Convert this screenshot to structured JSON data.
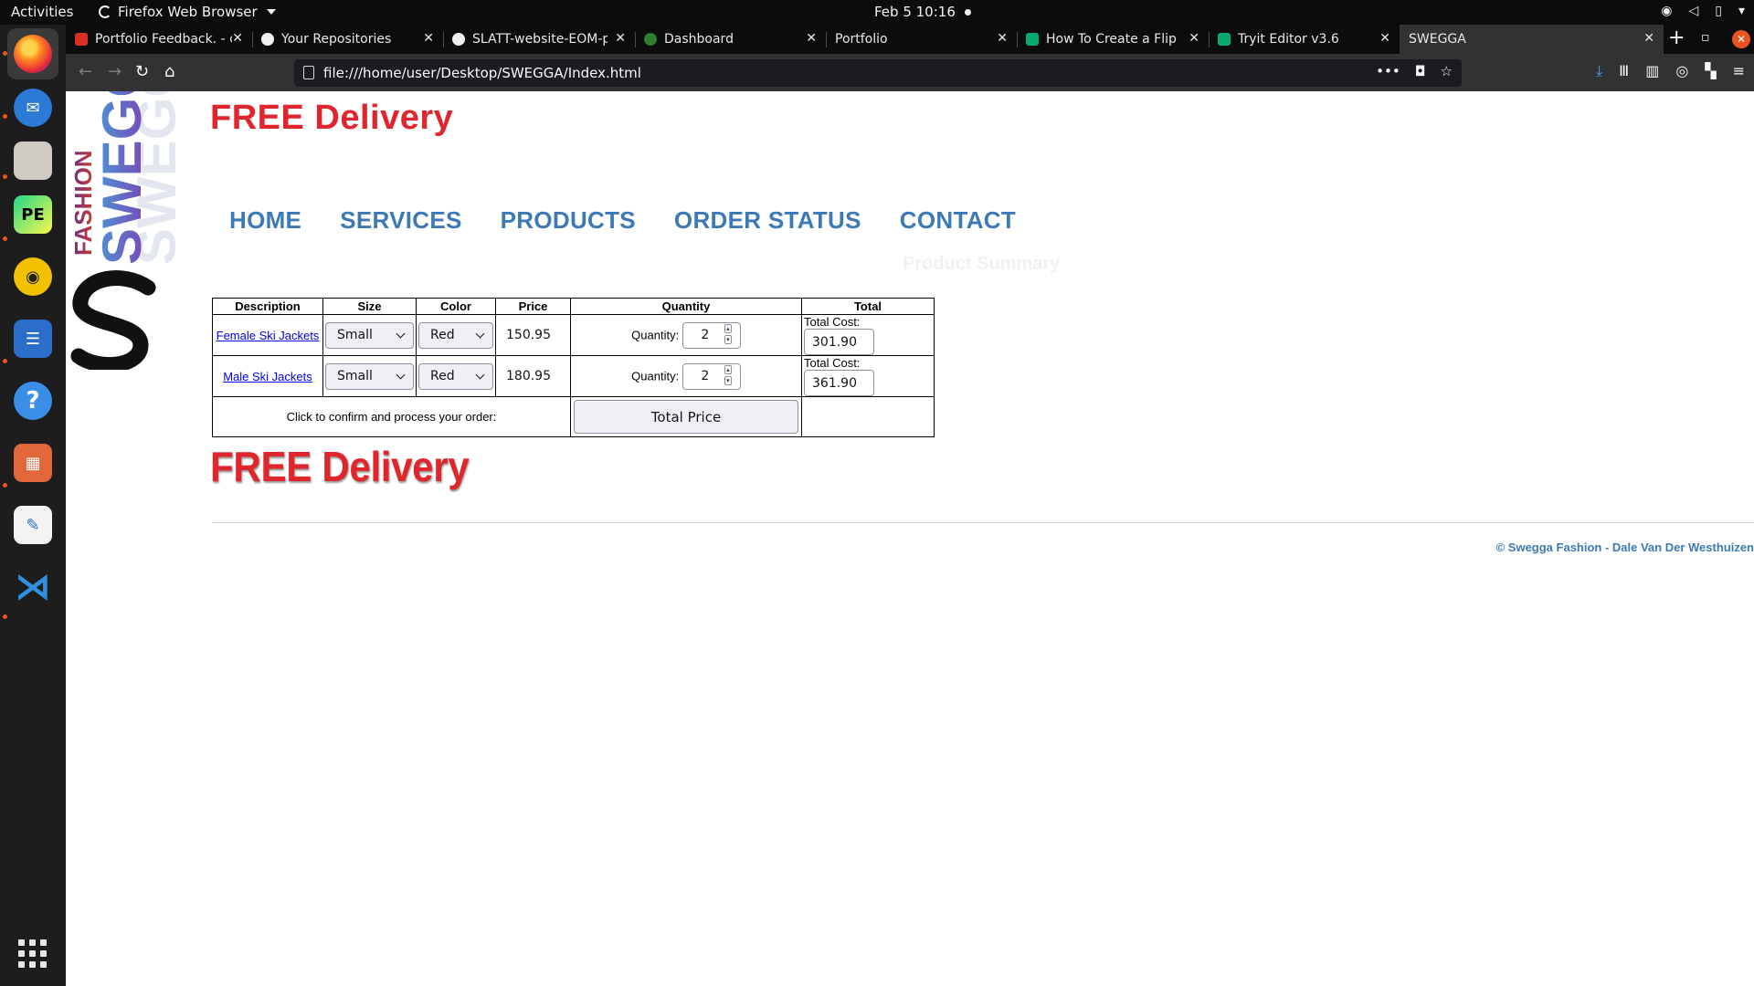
{
  "system": {
    "activities": "Activities",
    "app_menu": "Firefox Web Browser",
    "clock": "Feb 5  10:16"
  },
  "browser": {
    "tabs": [
      {
        "label": "Portfolio Feedback. - c",
        "icon": "gmail-icon",
        "color": "#d93025"
      },
      {
        "label": "Your Repositories",
        "icon": "github-icon",
        "color": "#f0f0f0"
      },
      {
        "label": "SLATT-website-EOM-p",
        "icon": "github-icon",
        "color": "#f0f0f0"
      },
      {
        "label": "Dashboard",
        "icon": "dashboard-icon",
        "color": "#2e7d32"
      },
      {
        "label": "Portfolio",
        "icon": "",
        "color": ""
      },
      {
        "label": "How To Create a Flip C",
        "icon": "w3-icon",
        "color": "#04aa6d"
      },
      {
        "label": "Tryit Editor v3.6",
        "icon": "w3-icon",
        "color": "#04aa6d"
      },
      {
        "label": "SWEGGA",
        "icon": "",
        "color": ""
      }
    ],
    "url": "file:///home/user/Desktop/SWEGGA/Index.html"
  },
  "page": {
    "logo": {
      "word1": "FASHION",
      "word2": "SWEGGA"
    },
    "free_delivery_top": "FREE Delivery",
    "free_delivery_bottom": "FREE Delivery",
    "nav": [
      "HOME",
      "SERVICES",
      "PRODUCTS",
      "ORDER STATUS",
      "CONTACT"
    ],
    "ghost_title": "Product Summary",
    "table": {
      "headers": [
        "Description",
        "Size",
        "Color",
        "Price",
        "Quantity",
        "Total"
      ],
      "rows": [
        {
          "description": "Female Ski Jackets",
          "size": "Small",
          "color": "Red",
          "price": "150.95",
          "quantity_label": "Quantity:",
          "quantity": "2",
          "total_label": "Total Cost:",
          "total": "301.90"
        },
        {
          "description": "Male Ski Jackets",
          "size": "Small",
          "color": "Red",
          "price": "180.95",
          "quantity_label": "Quantity:",
          "quantity": "2",
          "total_label": "Total Cost:",
          "total": "361.90"
        }
      ],
      "confirm_text": "Click to confirm and process your order:",
      "button_label": "Total Price"
    },
    "footer": "© Swegga Fashion - Dale Van Der Westhuizen"
  },
  "colors": {
    "accent_red": "#e0262d",
    "nav_blue": "#3d7ab5",
    "ubuntu_orange": "#e95420"
  }
}
